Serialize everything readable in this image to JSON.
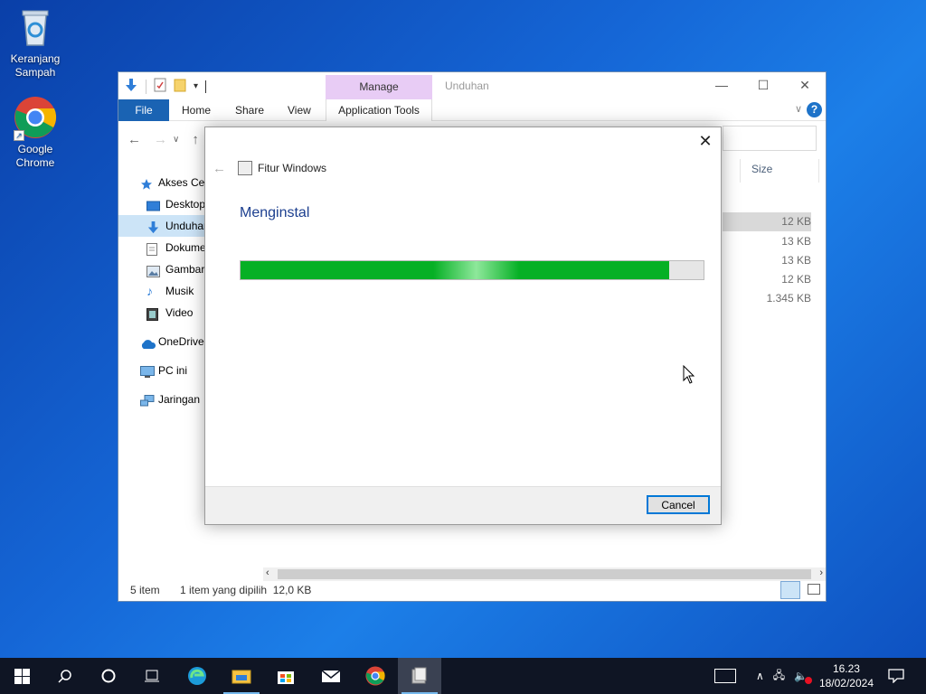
{
  "desktop": {
    "icons": [
      {
        "label_line1": "Keranjang",
        "label_line2": "Sampah",
        "icon": "recycle-bin-icon"
      },
      {
        "label_line1": "Google",
        "label_line2": "Chrome",
        "icon": "chrome-icon"
      }
    ]
  },
  "explorer": {
    "title": "Unduhan",
    "manage_label": "Manage",
    "ribbon_tabs": [
      "File",
      "Home",
      "Share",
      "View",
      "Application Tools"
    ],
    "help": "?",
    "nav_pane": [
      {
        "label": "Akses Cepat",
        "icon": "star-icon"
      },
      {
        "label": "Desktop",
        "icon": "desktop-folder-icon"
      },
      {
        "label": "Unduhan",
        "icon": "download-folder-icon",
        "selected": true
      },
      {
        "label": "Dokumen",
        "icon": "documents-icon"
      },
      {
        "label": "Gambar",
        "icon": "pictures-icon"
      },
      {
        "label": "Musik",
        "icon": "music-icon"
      },
      {
        "label": "Video",
        "icon": "video-icon"
      },
      {
        "label": "OneDrive",
        "icon": "onedrive-icon"
      },
      {
        "label": "PC ini",
        "icon": "pc-icon"
      },
      {
        "label": "Jaringan",
        "icon": "network-icon"
      }
    ],
    "size_header": "Size",
    "sizes": [
      "12 KB",
      "13 KB",
      "13 KB",
      "12 KB",
      "1.345 KB"
    ],
    "status": {
      "items": "5 item",
      "selected": "1 item yang dipilih  12,0 KB"
    }
  },
  "dialog": {
    "title": "Fitur Windows",
    "heading": "Menginstal",
    "progress": 0.926,
    "cancel_label": "Cancel"
  },
  "taskbar": {
    "time": "16.23",
    "date": "18/02/2024"
  },
  "colors": {
    "accent": "#0078d7",
    "progress_green": "#06b025",
    "file_tab": "#1a63b3",
    "manage_tab": "#e8ccf5"
  }
}
